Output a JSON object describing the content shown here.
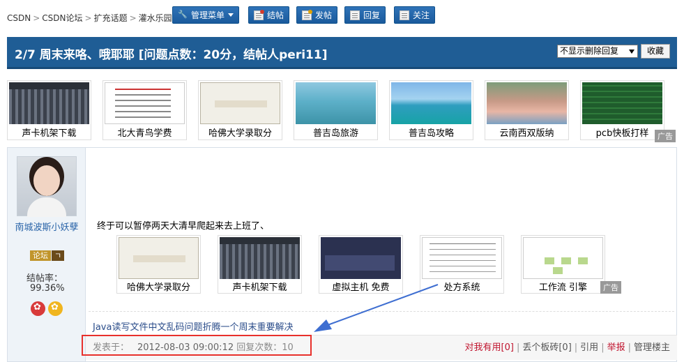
{
  "breadcrumb": [
    "CSDN",
    "CSDN论坛",
    "扩充话题",
    "灌水乐园"
  ],
  "toolbar": {
    "manage_label": "管理菜单",
    "close_label": "结帖",
    "post_label": "发帖",
    "reply_label": "回复",
    "follow_label": "关注"
  },
  "topic": {
    "title": "2/7 周末来咯、哦耶耶 [问题点数：20分，结帖人peri11]",
    "filter_selected": "不显示删除回复",
    "favorite_label": "收藏"
  },
  "ads_top": {
    "items": [
      "声卡机架下载",
      "北大青鸟学费",
      "哈佛大学录取分",
      "普吉岛旅游",
      "普吉岛攻略",
      "云南西双版纳",
      "pcb快板打样"
    ],
    "tag": "广告"
  },
  "post": {
    "author": "南城波斯小妖孽",
    "badge_primary": "论坛",
    "badge_secondary": "ㄱ",
    "rate_label": "结帖率：",
    "rate_value": "99.36%",
    "body": "终于可以暂停两天大清早爬起来去上班了、",
    "ads": {
      "items": [
        "哈佛大学录取分",
        "声卡机架下载",
        "虚拟主机 免费",
        "处方系统",
        "工作流 引擎"
      ],
      "tag": "广告"
    },
    "related_link": "Java读写文件中文乱码问题折腾一个周末重要解决",
    "posted_label": "发表于：",
    "posted_date": "2012-08-03 09:00:12",
    "reply_count_label": "回复次数：",
    "reply_count": "10",
    "actions": {
      "useful": "对我有用[0]",
      "brick": "丢个板砖[0]",
      "quote": "引用",
      "report": "举报",
      "manage": "管理楼主"
    }
  },
  "colors": {
    "title_bar": "#1f5d95",
    "button": "#1a5a9c",
    "highlight": "#e8302b",
    "arrow": "#3e6ed1"
  }
}
